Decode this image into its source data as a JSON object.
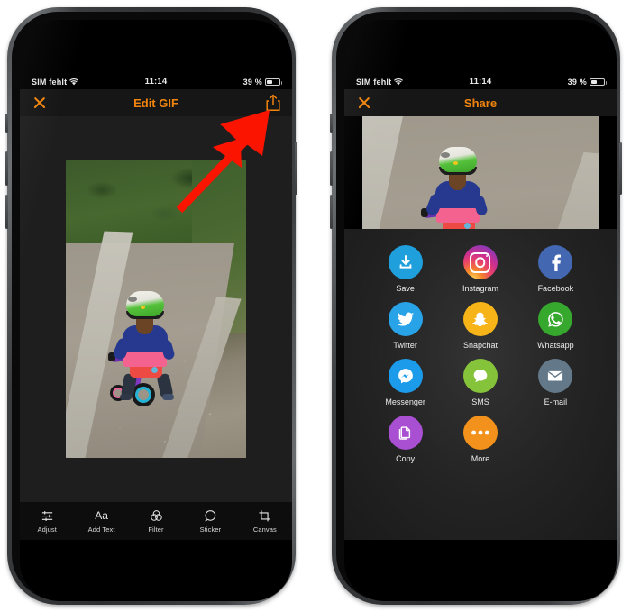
{
  "status_bar": {
    "carrier": "SIM fehlt",
    "time": "11:14",
    "battery": "39 %",
    "battery_level_percent": 39,
    "wifi_icon": "wifi-icon"
  },
  "left_phone": {
    "nav": {
      "close_icon": "close-icon",
      "title": "Edit GIF",
      "share_icon": "share-icon",
      "accent_color": "#f0840e"
    },
    "toolbar": [
      {
        "label": "Adjust",
        "icon": "sliders-icon"
      },
      {
        "label": "Add Text",
        "icon": "text-aa-icon"
      },
      {
        "label": "Filter",
        "icon": "filter-circles-icon"
      },
      {
        "label": "Sticker",
        "icon": "sticker-icon"
      },
      {
        "label": "Canvas",
        "icon": "crop-frame-icon"
      }
    ],
    "photo_alt": "child in green helmet riding a balance bike on a gravel path"
  },
  "annotation": {
    "arrow_color": "#fb1400",
    "points_to": "share-icon"
  },
  "right_phone": {
    "nav": {
      "close_icon": "close-icon",
      "title": "Share",
      "accent_color": "#f0840e"
    },
    "share_options": [
      {
        "label": "Save",
        "icon": "download-icon",
        "color": "#1f9fdc"
      },
      {
        "label": "Instagram",
        "icon": "instagram-icon",
        "color": "#d6306f"
      },
      {
        "label": "Facebook",
        "icon": "facebook-icon",
        "color": "#4367b0"
      },
      {
        "label": "Twitter",
        "icon": "twitter-bird-icon",
        "color": "#28a3e8"
      },
      {
        "label": "Snapchat",
        "icon": "snapchat-ghost-icon",
        "color": "#f7b418"
      },
      {
        "label": "Whatsapp",
        "icon": "whatsapp-icon",
        "color": "#36a82e"
      },
      {
        "label": "Messenger",
        "icon": "messenger-icon",
        "color": "#1b9bea"
      },
      {
        "label": "SMS",
        "icon": "speech-bubble-icon",
        "color": "#85c33b"
      },
      {
        "label": "E-mail",
        "icon": "envelope-icon",
        "color": "#63798a"
      },
      {
        "label": "Copy",
        "icon": "copy-pages-icon",
        "color": "#a94fd1"
      },
      {
        "label": "More",
        "icon": "ellipsis-icon",
        "color": "#f2911b"
      }
    ]
  }
}
